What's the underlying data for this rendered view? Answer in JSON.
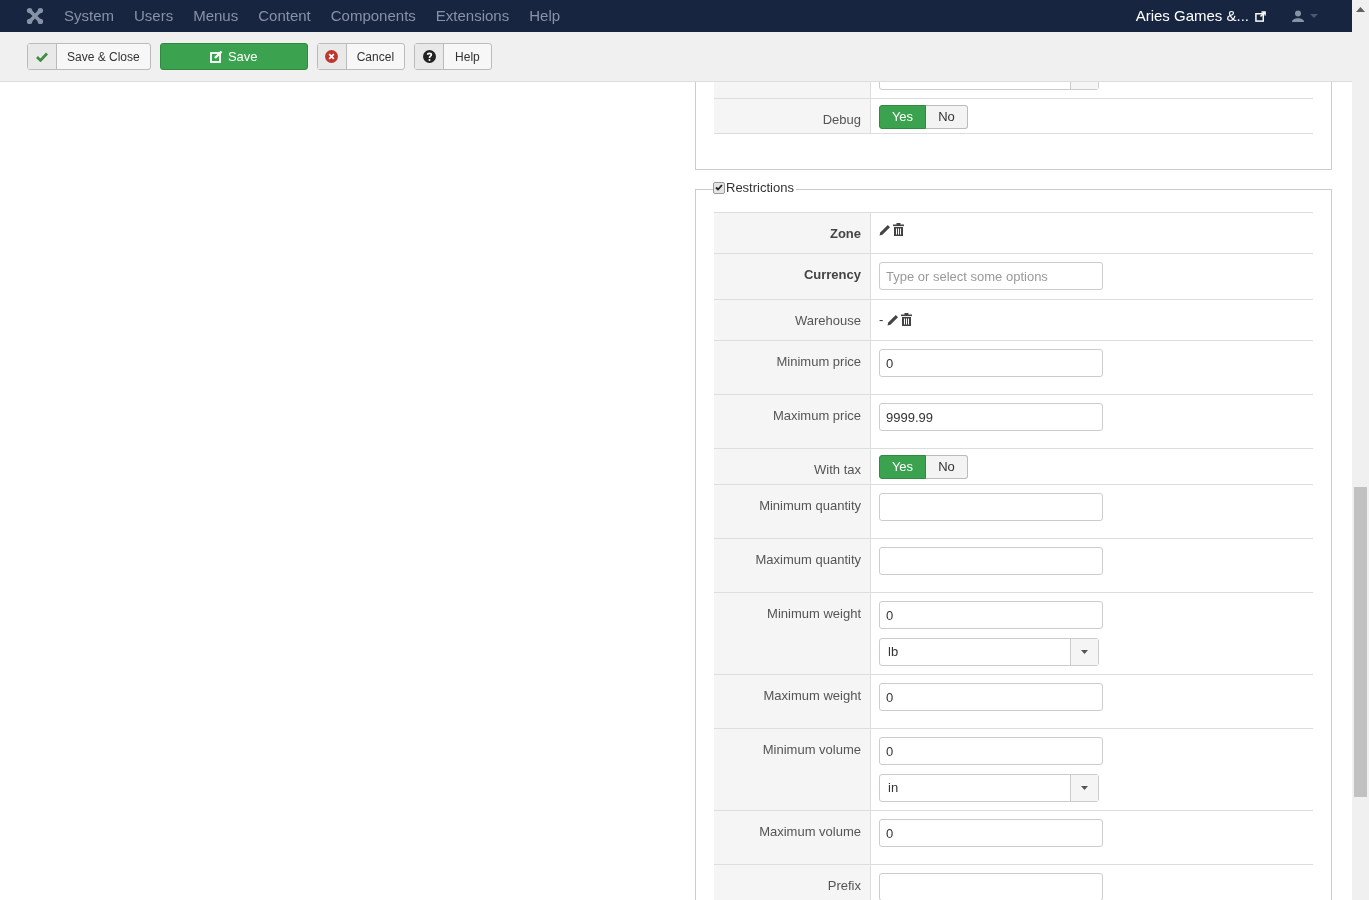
{
  "navbar": {
    "menu": [
      "System",
      "Users",
      "Menus",
      "Content",
      "Components",
      "Extensions",
      "Help"
    ],
    "site_name": "Aries Games &..."
  },
  "toolbar": {
    "buttons": [
      {
        "kind": "save_close",
        "label": "Save & Close"
      },
      {
        "kind": "save",
        "label": "Save"
      },
      {
        "kind": "cancel",
        "label": "Cancel"
      },
      {
        "kind": "help",
        "label": "Help"
      }
    ]
  },
  "general_fieldset": {
    "rows": [
      {
        "kind": "select_partial"
      },
      {
        "kind": "toggle",
        "label": "Debug",
        "options": [
          {
            "label": "Yes",
            "selected": true
          },
          {
            "label": "No",
            "selected": false
          }
        ]
      }
    ]
  },
  "restrictions": {
    "legend": "Restrictions",
    "checked": true,
    "rows": [
      {
        "kind": "icons",
        "label": "Zone",
        "bold": true
      },
      {
        "kind": "multiselect",
        "label": "Currency",
        "bold": true,
        "placeholder": "Type or select some options"
      },
      {
        "kind": "icons",
        "label": "Warehouse",
        "bold": false,
        "value": "-"
      },
      {
        "kind": "text",
        "label": "Minimum price",
        "value": "0"
      },
      {
        "kind": "text",
        "label": "Maximum price",
        "value": "9999.99"
      },
      {
        "kind": "toggle",
        "label": "With tax",
        "options": [
          {
            "label": "Yes",
            "selected": true
          },
          {
            "label": "No",
            "selected": false
          }
        ]
      },
      {
        "kind": "text",
        "label": "Minimum quantity",
        "value": ""
      },
      {
        "kind": "text",
        "label": "Maximum quantity",
        "value": ""
      },
      {
        "kind": "text_unit",
        "label": "Minimum weight",
        "value": "0",
        "unit": "lb"
      },
      {
        "kind": "text",
        "label": "Maximum weight",
        "value": "0"
      },
      {
        "kind": "text_unit",
        "label": "Minimum volume",
        "value": "0",
        "unit": "in"
      },
      {
        "kind": "text",
        "label": "Maximum volume",
        "value": "0"
      },
      {
        "kind": "text",
        "label": "Prefix",
        "value": ""
      }
    ]
  }
}
